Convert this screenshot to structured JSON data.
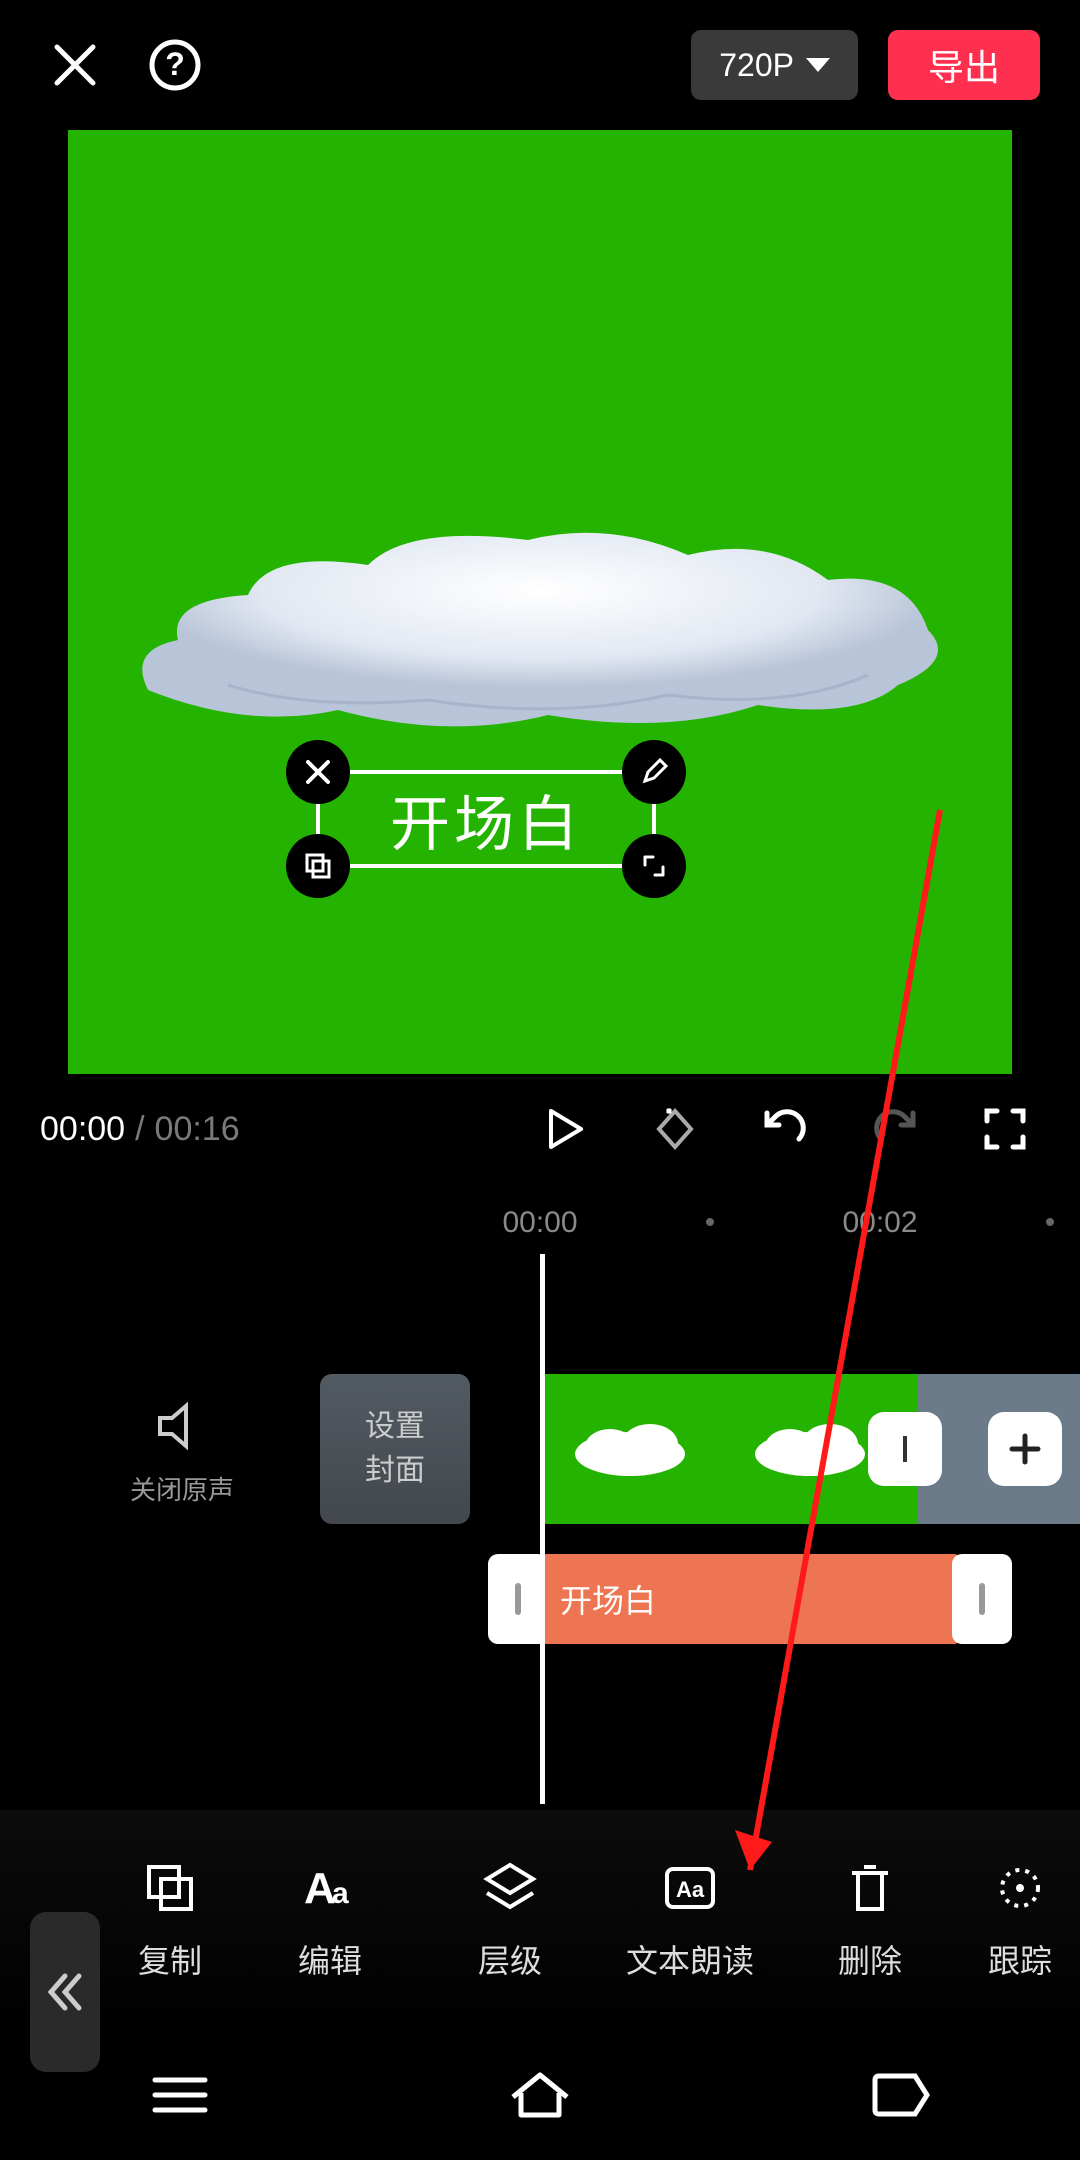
{
  "header": {
    "resolution_label": "720P",
    "export_label": "导出"
  },
  "preview": {
    "selected_text": "开场白"
  },
  "playback": {
    "current_time": "00:00",
    "total_time": "00:16"
  },
  "ruler": {
    "t0": "00:00",
    "t1": "00:02"
  },
  "timeline": {
    "audio_label": "关闭原声",
    "cover_label_line1": "设置",
    "cover_label_line2": "封面",
    "text_clip_label": "开场白",
    "transition_plus": "+"
  },
  "toolbar": {
    "items": [
      {
        "label": "复制"
      },
      {
        "label": "编辑"
      },
      {
        "label": "层级"
      },
      {
        "label": "文本朗读"
      },
      {
        "label": "删除"
      },
      {
        "label": "跟踪"
      }
    ]
  }
}
